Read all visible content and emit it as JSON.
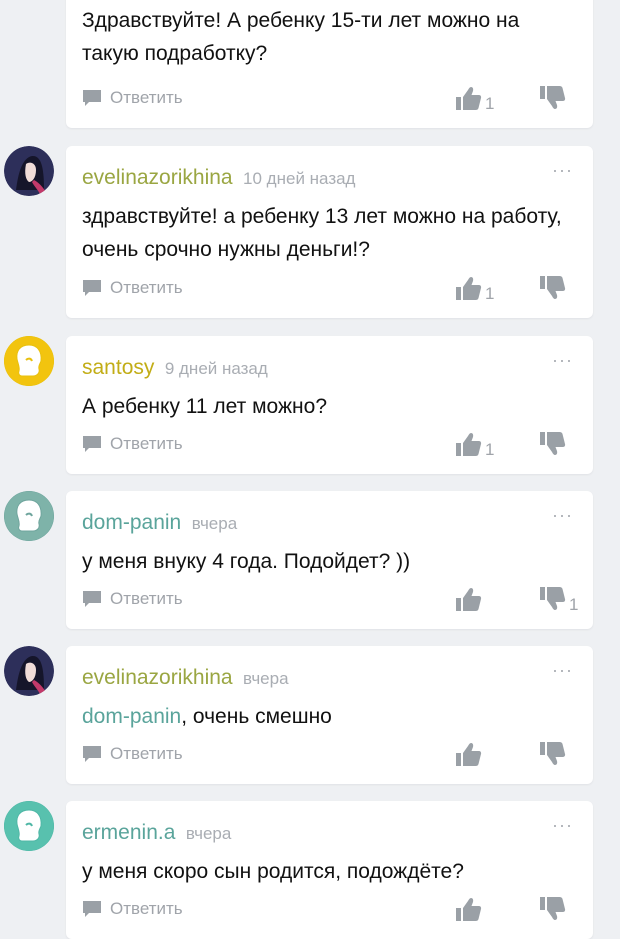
{
  "reply_label": "Ответить",
  "more_label": "···",
  "colors": {
    "olive": "#9aa642",
    "gold": "#c2ad16",
    "teal": "#5aa49b",
    "icon": "#9aa0a6",
    "muted": "#a9adb3"
  },
  "comments": [
    {
      "author": "",
      "time": "",
      "text": "Здравствуйте! А ребенку 15-ти лет можно на такую подработку?",
      "likes": "1",
      "dislikes": ""
    },
    {
      "author": "evelinazorikhina",
      "time": "10 дней назад",
      "text": "здравствуйте! а ребенку 13 лет можно на работу, очень срочно нужны деньги!?",
      "likes": "1",
      "dislikes": ""
    },
    {
      "author": "santosy",
      "time": "9 дней назад",
      "text": "А ребенку 11 лет можно?",
      "likes": "1",
      "dislikes": ""
    },
    {
      "author": "dom-panin",
      "time": "вчера",
      "text": "у меня внуку 4 года. Подойдет? ))",
      "likes": "",
      "dislikes": "1"
    },
    {
      "author": "evelinazorikhina",
      "time": "вчера",
      "mention": "dom-panin",
      "text": ", очень смешно",
      "likes": "",
      "dislikes": ""
    },
    {
      "author": "ermenin.a",
      "time": "вчера",
      "text": "у меня скоро сын родится, подождёте?",
      "likes": "",
      "dislikes": ""
    }
  ]
}
